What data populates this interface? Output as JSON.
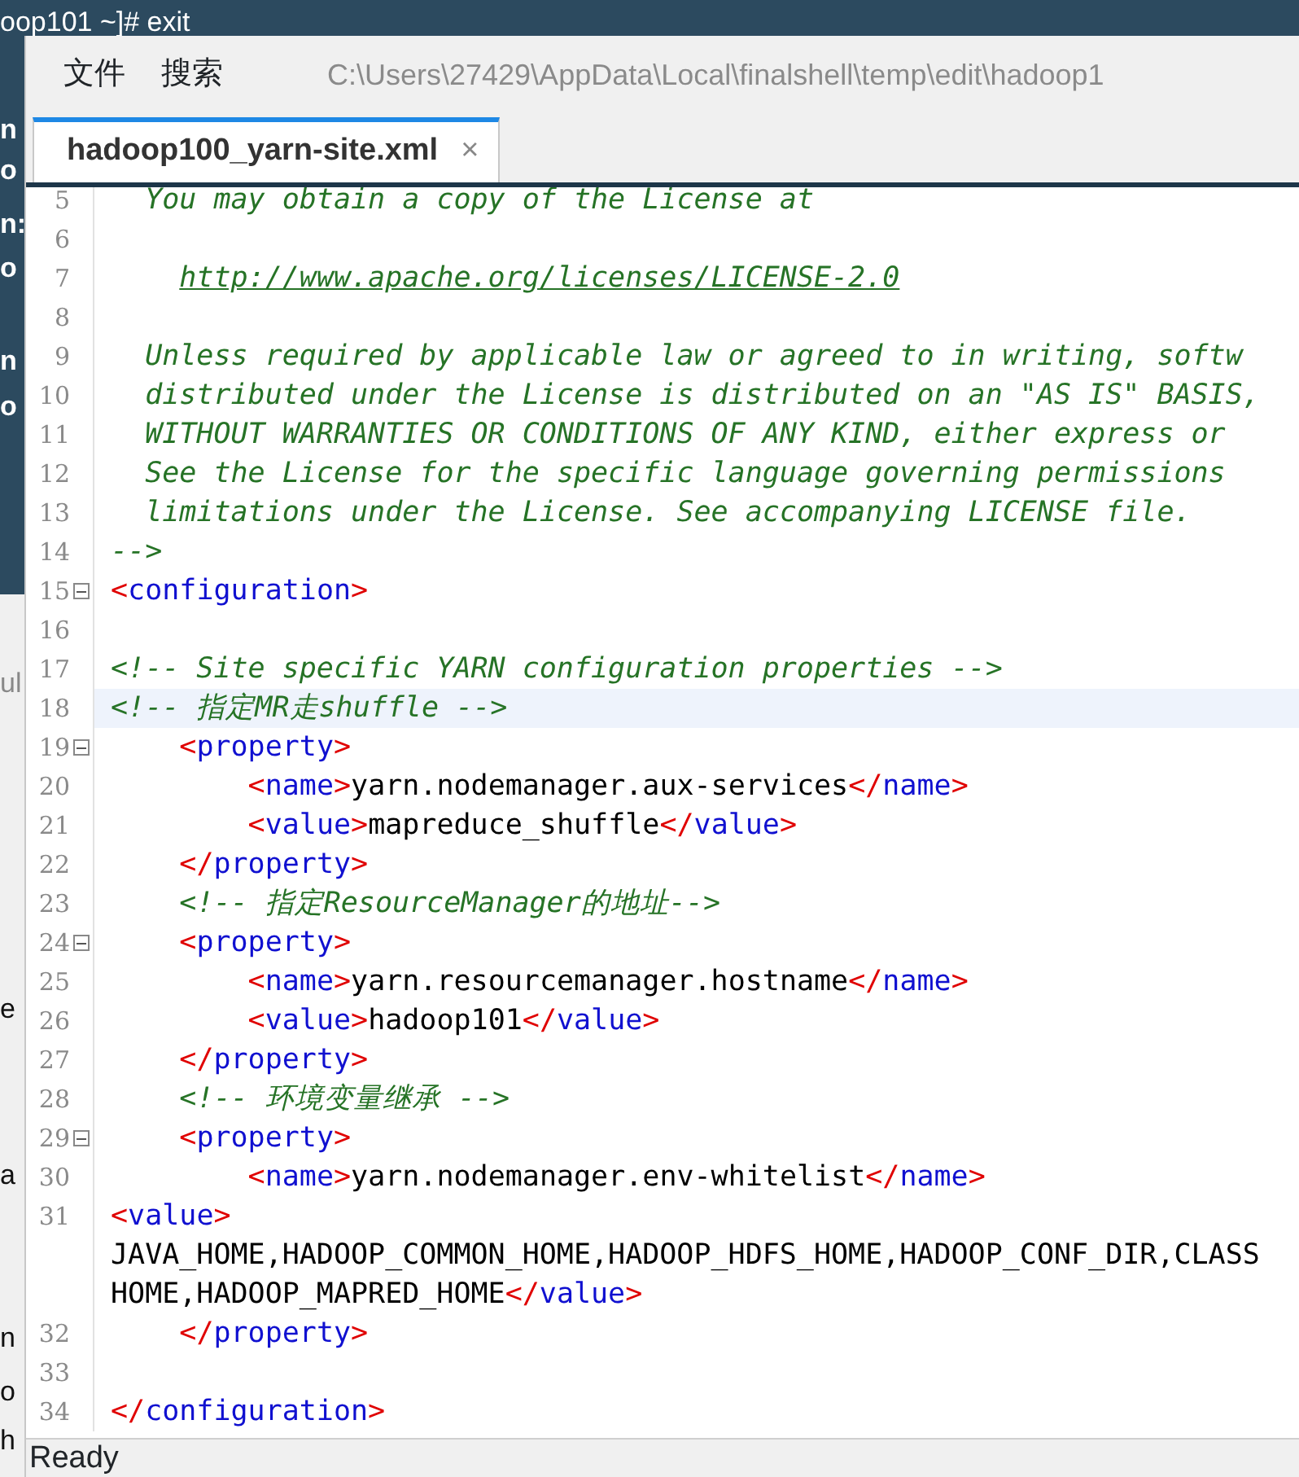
{
  "desktop": {
    "terminal_top_line": "oop101 ~]# exit",
    "left_fragments": [
      {
        "text": "n",
        "kind": "dark"
      },
      {
        "text": "o",
        "kind": "dark"
      },
      {
        "text": "n:",
        "kind": "dark"
      },
      {
        "text": "o",
        "kind": "dark"
      },
      {
        "text": "n",
        "kind": "dark"
      },
      {
        "text": "o",
        "kind": "dark"
      },
      {
        "text": "ul",
        "kind": "light"
      },
      {
        "text": "e",
        "kind": "light"
      },
      {
        "text": "a",
        "kind": "light"
      },
      {
        "text": "n",
        "kind": "light"
      },
      {
        "text": "o",
        "kind": "light"
      },
      {
        "text": "h",
        "kind": "light"
      }
    ]
  },
  "window": {
    "menu": [
      "文件",
      "搜索"
    ],
    "path": "C:\\Users\\27429\\AppData\\Local\\finalshell\\temp\\edit\\hadoop1",
    "tabs": [
      {
        "label": "hadoop100_yarn-site.xml",
        "close": "×",
        "selected": true
      }
    ],
    "lines": [
      {
        "number": "5",
        "segments": [
          {
            "kind": "comment",
            "text": "  You may obtain a copy of the License at"
          }
        ]
      },
      {
        "number": "6"
      },
      {
        "number": "7",
        "segments": [
          {
            "kind": "link",
            "text": "    http://www.apache.org/licenses/LICENSE-2.0"
          }
        ]
      },
      {
        "number": "8"
      },
      {
        "number": "9",
        "segments": [
          {
            "kind": "comment",
            "text": "  Unless required by applicable law or agreed to in writing, softw"
          }
        ]
      },
      {
        "number": "10",
        "segments": [
          {
            "kind": "comment",
            "text": "  distributed under the License is distributed on an \"AS IS\" BASIS,"
          }
        ]
      },
      {
        "number": "11",
        "segments": [
          {
            "kind": "comment",
            "text": "  WITHOUT WARRANTIES OR CONDITIONS OF ANY KIND, either express or"
          }
        ]
      },
      {
        "number": "12",
        "segments": [
          {
            "kind": "comment",
            "text": "  See the License for the specific language governing permissions"
          }
        ]
      },
      {
        "number": "13",
        "segments": [
          {
            "kind": "comment",
            "text": "  limitations under the License. See accompanying LICENSE file."
          }
        ]
      },
      {
        "number": "14",
        "segments": [
          {
            "kind": "comment",
            "text": "-->"
          }
        ]
      },
      {
        "number": "15",
        "fold": true,
        "segments": [
          {
            "kind": "punct",
            "text": "<"
          },
          {
            "kind": "tag",
            "text": "configuration"
          },
          {
            "kind": "punct",
            "text": ">"
          }
        ]
      },
      {
        "number": "16"
      },
      {
        "number": "17",
        "segments": [
          {
            "kind": "comment",
            "text": "<!-- Site specific YARN configuration properties -->"
          }
        ]
      },
      {
        "number": "18",
        "highlighted": true,
        "segments": [
          {
            "kind": "comment",
            "text": "<!-- 指定MR走shuffle -->"
          }
        ]
      },
      {
        "number": "19",
        "fold": true,
        "segments": [
          {
            "kind": "punct",
            "text": "    <"
          },
          {
            "kind": "tag",
            "text": "property"
          },
          {
            "kind": "punct",
            "text": ">"
          }
        ]
      },
      {
        "number": "20",
        "segments": [
          {
            "kind": "punct",
            "text": "        <"
          },
          {
            "kind": "tag",
            "text": "name"
          },
          {
            "kind": "punct",
            "text": ">"
          },
          {
            "kind": "text",
            "text": "yarn.nodemanager.aux-services"
          },
          {
            "kind": "punct",
            "text": "</"
          },
          {
            "kind": "tag",
            "text": "name"
          },
          {
            "kind": "punct",
            "text": ">"
          }
        ]
      },
      {
        "number": "21",
        "segments": [
          {
            "kind": "punct",
            "text": "        <"
          },
          {
            "kind": "tag",
            "text": "value"
          },
          {
            "kind": "punct",
            "text": ">"
          },
          {
            "kind": "text",
            "text": "mapreduce_shuffle"
          },
          {
            "kind": "punct",
            "text": "</"
          },
          {
            "kind": "tag",
            "text": "value"
          },
          {
            "kind": "punct",
            "text": ">"
          }
        ]
      },
      {
        "number": "22",
        "segments": [
          {
            "kind": "punct",
            "text": "    </"
          },
          {
            "kind": "tag",
            "text": "property"
          },
          {
            "kind": "punct",
            "text": ">"
          }
        ]
      },
      {
        "number": "23",
        "segments": [
          {
            "kind": "comment",
            "text": "    <!-- 指定ResourceManager的地址-->"
          }
        ]
      },
      {
        "number": "24",
        "fold": true,
        "segments": [
          {
            "kind": "punct",
            "text": "    <"
          },
          {
            "kind": "tag",
            "text": "property"
          },
          {
            "kind": "punct",
            "text": ">"
          }
        ]
      },
      {
        "number": "25",
        "segments": [
          {
            "kind": "punct",
            "text": "        <"
          },
          {
            "kind": "tag",
            "text": "name"
          },
          {
            "kind": "punct",
            "text": ">"
          },
          {
            "kind": "text",
            "text": "yarn.resourcemanager.hostname"
          },
          {
            "kind": "punct",
            "text": "</"
          },
          {
            "kind": "tag",
            "text": "name"
          },
          {
            "kind": "punct",
            "text": ">"
          }
        ]
      },
      {
        "number": "26",
        "segments": [
          {
            "kind": "punct",
            "text": "        <"
          },
          {
            "kind": "tag",
            "text": "value"
          },
          {
            "kind": "punct",
            "text": ">"
          },
          {
            "kind": "text",
            "text": "hadoop101"
          },
          {
            "kind": "punct",
            "text": "</"
          },
          {
            "kind": "tag",
            "text": "value"
          },
          {
            "kind": "punct",
            "text": ">"
          }
        ]
      },
      {
        "number": "27",
        "segments": [
          {
            "kind": "punct",
            "text": "    </"
          },
          {
            "kind": "tag",
            "text": "property"
          },
          {
            "kind": "punct",
            "text": ">"
          }
        ]
      },
      {
        "number": "28",
        "segments": [
          {
            "kind": "comment",
            "text": "    <!-- 环境变量继承 -->"
          }
        ]
      },
      {
        "number": "29",
        "fold": true,
        "segments": [
          {
            "kind": "punct",
            "text": "    <"
          },
          {
            "kind": "tag",
            "text": "property"
          },
          {
            "kind": "punct",
            "text": ">"
          }
        ]
      },
      {
        "number": "30",
        "segments": [
          {
            "kind": "punct",
            "text": "        <"
          },
          {
            "kind": "tag",
            "text": "name"
          },
          {
            "kind": "punct",
            "text": ">"
          },
          {
            "kind": "text",
            "text": "yarn.nodemanager.env-whitelist"
          },
          {
            "kind": "punct",
            "text": "</"
          },
          {
            "kind": "tag",
            "text": "name"
          },
          {
            "kind": "punct",
            "text": ">"
          }
        ]
      },
      {
        "number": "31",
        "segments": [
          {
            "kind": "punct",
            "text": "<"
          },
          {
            "kind": "tag",
            "text": "value"
          },
          {
            "kind": "punct",
            "text": ">"
          }
        ]
      },
      {
        "segments": [
          {
            "kind": "text",
            "text": "JAVA_HOME,HADOOP_COMMON_HOME,HADOOP_HDFS_HOME,HADOOP_CONF_DIR,CLASS"
          }
        ]
      },
      {
        "segments": [
          {
            "kind": "text",
            "text": "HOME,HADOOP_MAPRED_HOME"
          },
          {
            "kind": "punct",
            "text": "</"
          },
          {
            "kind": "tag",
            "text": "value"
          },
          {
            "kind": "punct",
            "text": ">"
          }
        ]
      },
      {
        "number": "32",
        "segments": [
          {
            "kind": "punct",
            "text": "    </"
          },
          {
            "kind": "tag",
            "text": "property"
          },
          {
            "kind": "punct",
            "text": ">"
          }
        ]
      },
      {
        "number": "33"
      },
      {
        "number": "34",
        "segments": [
          {
            "kind": "punct",
            "text": "</"
          },
          {
            "kind": "tag",
            "text": "configuration"
          },
          {
            "kind": "punct",
            "text": ">"
          }
        ]
      }
    ],
    "status": "Ready"
  }
}
